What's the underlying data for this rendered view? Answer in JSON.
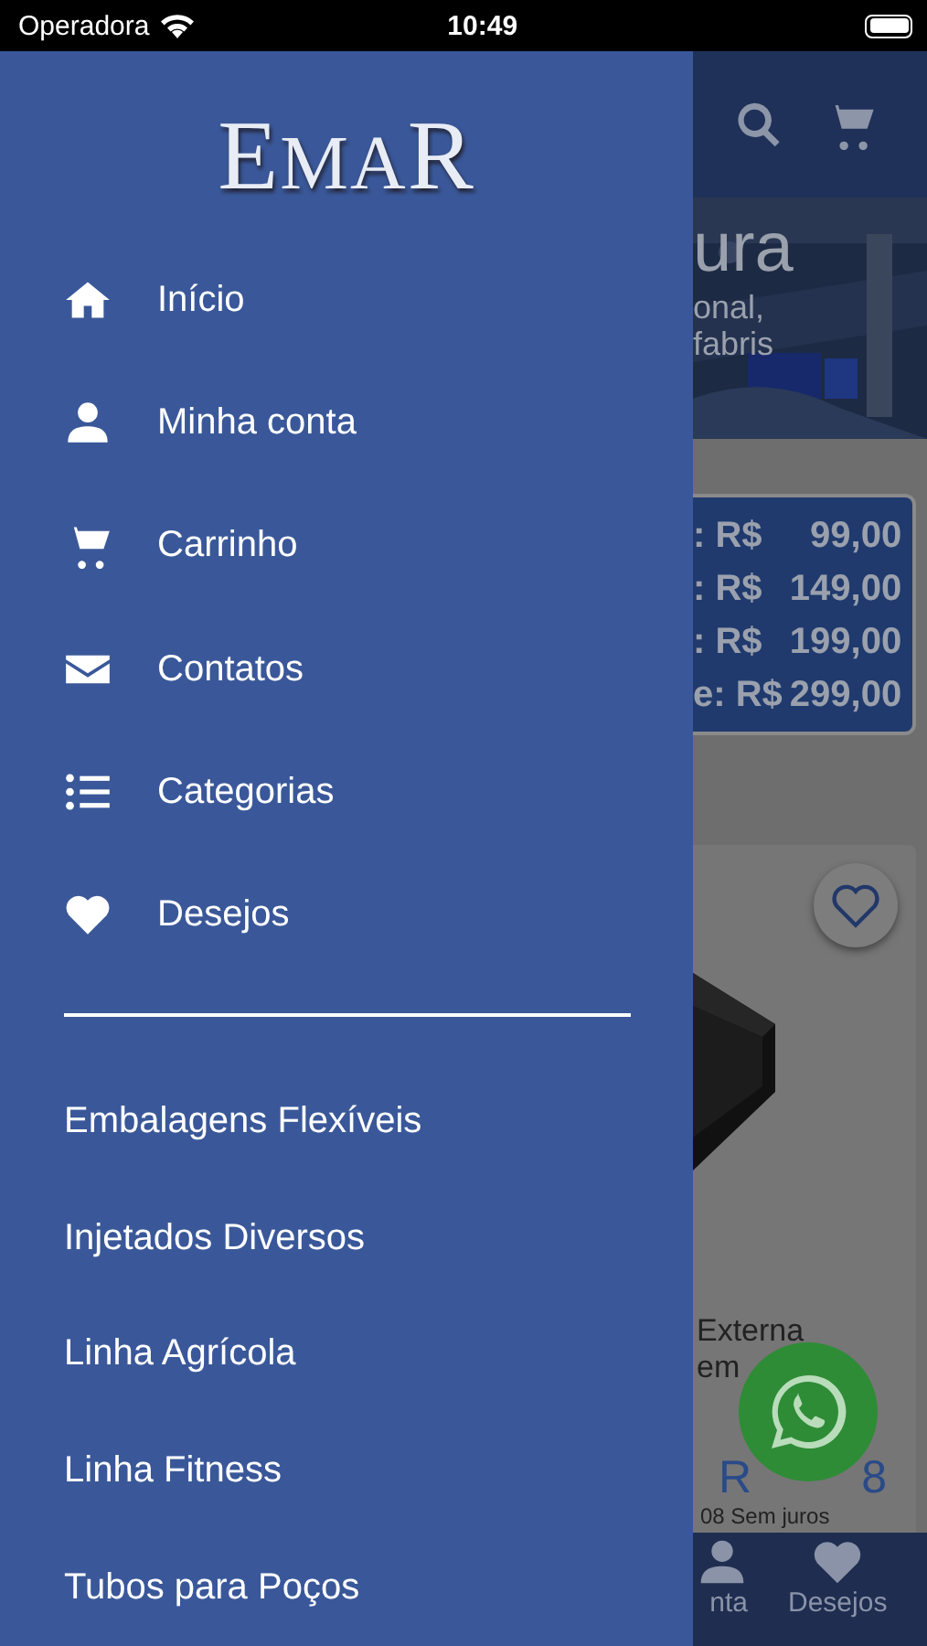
{
  "status_bar": {
    "carrier": "Operadora",
    "time": "10:49"
  },
  "drawer": {
    "logo": "EMAR",
    "menu": [
      {
        "label": "Início",
        "kind": "home"
      },
      {
        "label": "Minha conta",
        "kind": "user"
      },
      {
        "label": "Carrinho",
        "kind": "cart"
      },
      {
        "label": "Contatos",
        "kind": "mail"
      },
      {
        "label": "Categorias",
        "kind": "list"
      },
      {
        "label": "Desejos",
        "kind": "heart"
      }
    ],
    "categories": [
      "Embalagens Flexíveis",
      "Injetados Diversos",
      "Linha Agrícola",
      "Linha Fitness",
      "Tubos para Poços"
    ]
  },
  "background": {
    "banner": {
      "title": "ura",
      "lines": [
        "onal,",
        "fabris"
      ]
    },
    "prices": [
      ": R$",
      "99,00",
      ": R$",
      "149,00",
      ": R$",
      "199,00",
      "e: R$",
      "299,00"
    ],
    "product": {
      "name_lines": [
        "Externa",
        "em"
      ],
      "price_parts": [
        "R",
        "8"
      ],
      "installments": "08 Sem juros"
    },
    "tab_bar": [
      {
        "label": "nta",
        "kind": "user"
      },
      {
        "label": "Desejos",
        "kind": "heart"
      }
    ]
  }
}
